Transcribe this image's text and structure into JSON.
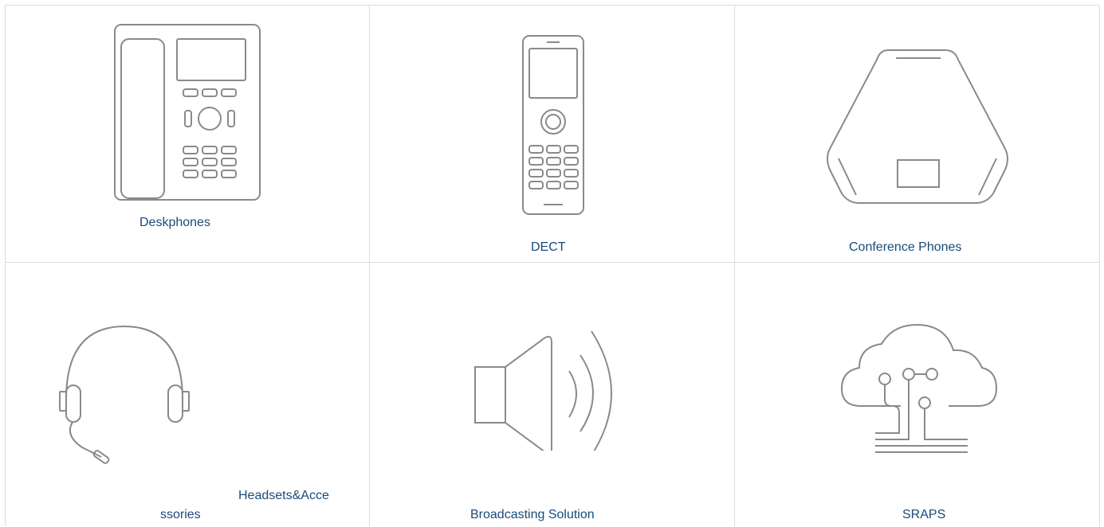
{
  "products": [
    {
      "label": "Deskphones",
      "icon": "deskphone-icon"
    },
    {
      "label": "DECT",
      "icon": "dect-phone-icon"
    },
    {
      "label": "Conference Phones",
      "icon": "conference-phone-icon"
    },
    {
      "label_line1": "Headsets&Acce",
      "label_line2": "ssories",
      "icon": "headset-icon"
    },
    {
      "label": "Broadcasting Solution",
      "icon": "speaker-icon"
    },
    {
      "label": "SRAPS",
      "icon": "cloud-network-icon"
    }
  ]
}
